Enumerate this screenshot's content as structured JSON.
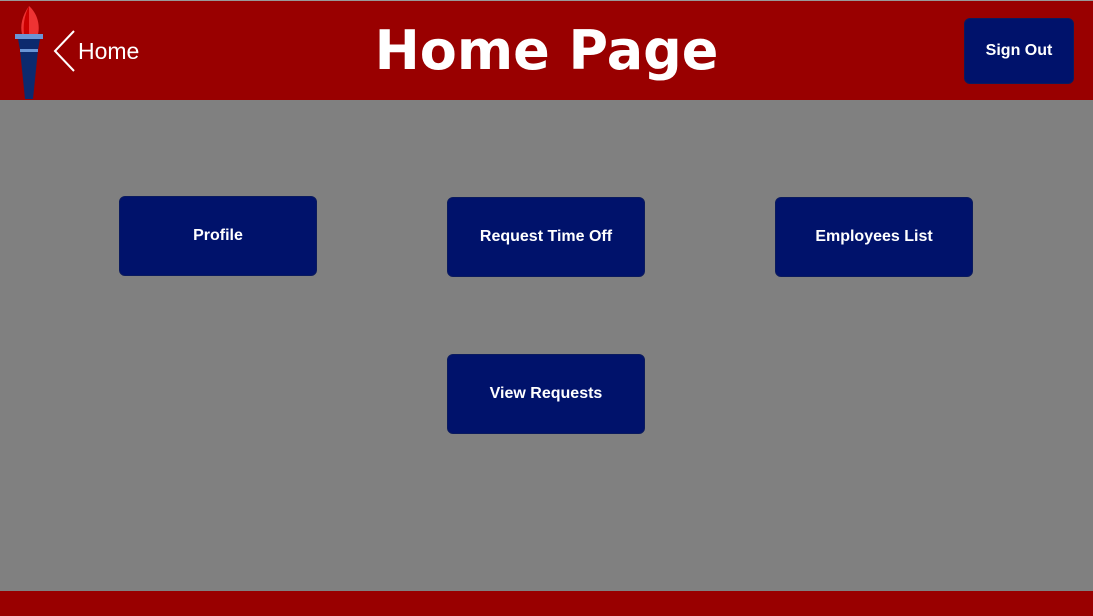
{
  "header": {
    "back_label": "Home",
    "title": "Home Page",
    "sign_out": "Sign Out"
  },
  "buttons": {
    "profile": "Profile",
    "request_time_off": "Request Time Off",
    "employees_list": "Employees List",
    "view_requests": "View Requests"
  },
  "colors": {
    "header": "#990000",
    "background": "#808080",
    "button": "#00126b"
  }
}
